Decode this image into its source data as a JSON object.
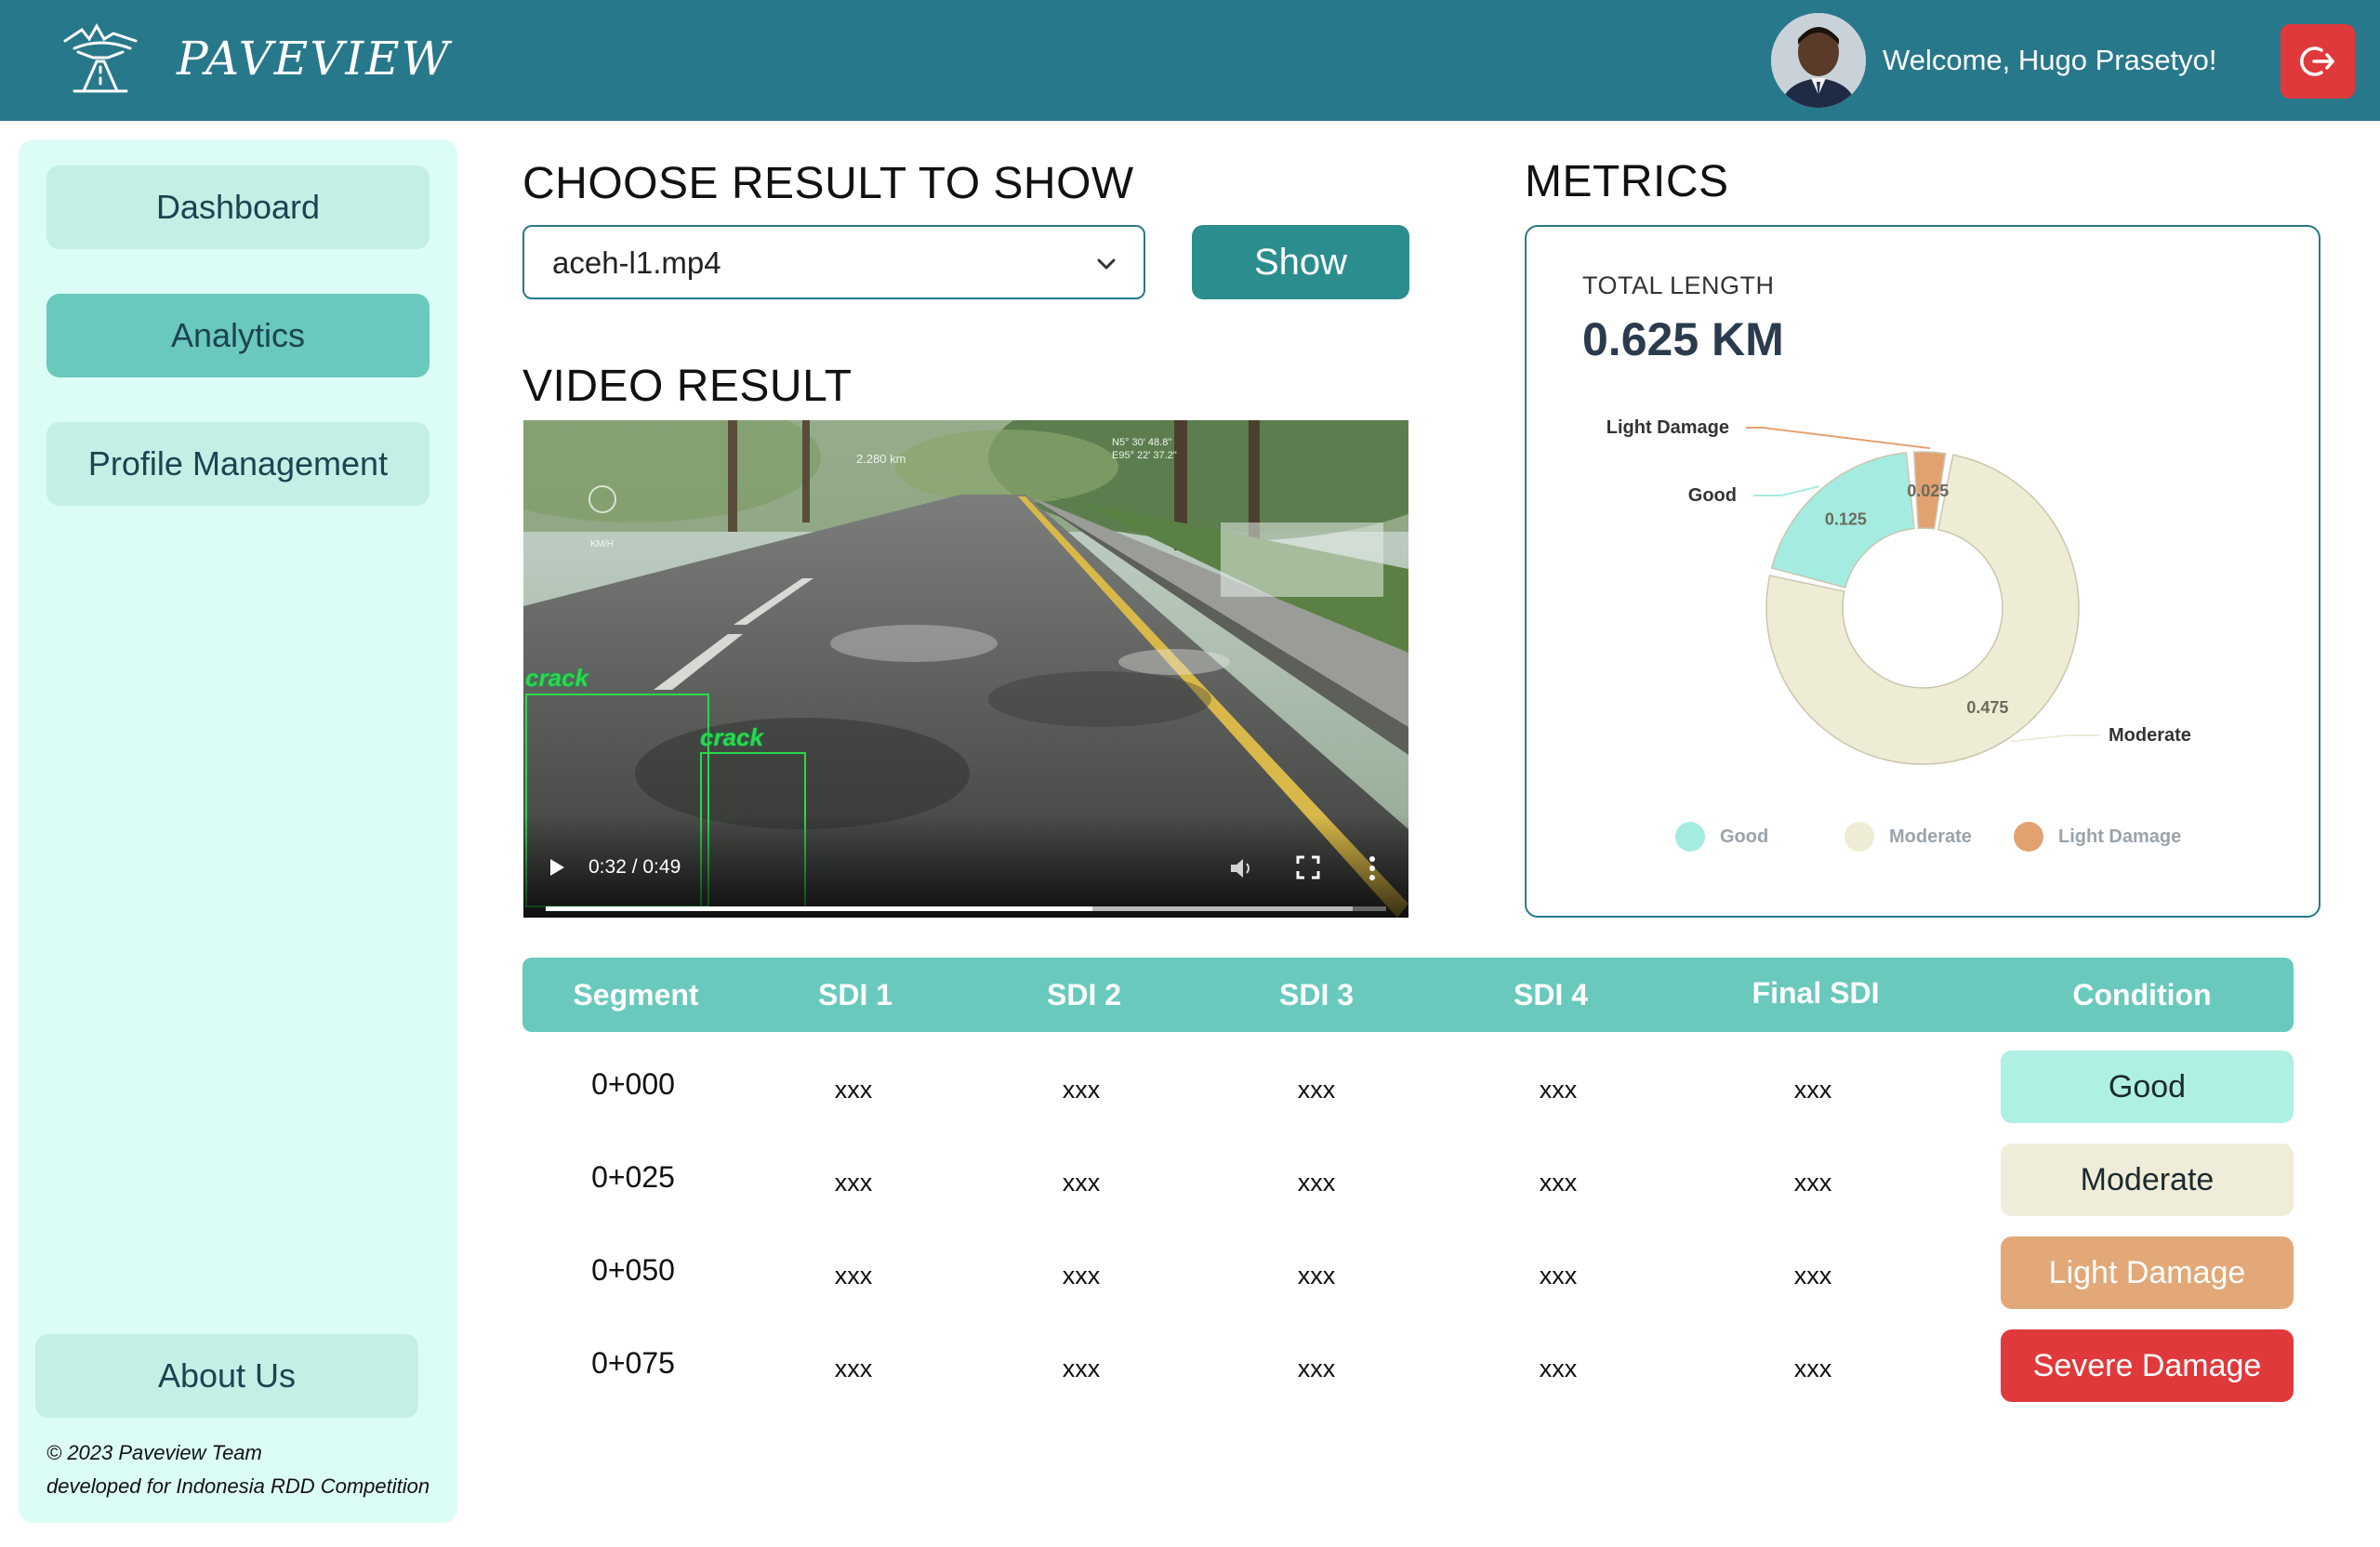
{
  "app": {
    "brand": "PAVEVIEW",
    "welcome_text": "Welcome, Hugo Prasetyo!",
    "icons": {
      "logo": "garuda-road-logo-icon",
      "logout": "logout-icon"
    }
  },
  "sidebar": {
    "items": [
      {
        "label": "Dashboard",
        "active": false
      },
      {
        "label": "Analytics",
        "active": true
      },
      {
        "label": "Profile Management",
        "active": false
      }
    ],
    "about_label": "About Us",
    "footer_line1": "© 2023 Paveview Team",
    "footer_line2": "developed for Indonesia RDD Competition"
  },
  "choose": {
    "heading": "CHOOSE RESULT TO SHOW",
    "selected": "aceh-l1.mp4",
    "show_label": "Show"
  },
  "video": {
    "heading": "VIDEO RESULT",
    "time": "0:32 / 0:49",
    "progress": 0.65,
    "buffered": 0.96,
    "detections": [
      "crack",
      "crack"
    ],
    "overlay_distance": "2.280 km",
    "overlay_speed_unit": "KM/H",
    "overlay_coords_1": "N5° 30' 48.8\"",
    "overlay_coords_2": "E95° 22' 37.2\""
  },
  "metrics": {
    "heading": "METRICS",
    "total_label": "TOTAL LENGTH",
    "total_value": "0.625 KM",
    "chart_data": {
      "type": "pie",
      "categories": [
        "Good",
        "Moderate",
        "Light Damage"
      ],
      "values": [
        0.125,
        0.475,
        0.025
      ],
      "value_labels": [
        "0.125",
        "0.475",
        "0.025"
      ],
      "colors": [
        "#a4ece1",
        "#efecd6",
        "#e2a270"
      ],
      "legend_position": "bottom"
    }
  },
  "table": {
    "headers": [
      "Segment",
      "SDI 1",
      "SDI 2",
      "SDI 3",
      "SDI 4",
      "Final SDI",
      "Condition"
    ],
    "rows": [
      {
        "segment": "0+000",
        "sdi1": "xxx",
        "sdi2": "xxx",
        "sdi3": "xxx",
        "sdi4": "xxx",
        "final": "xxx",
        "condition": "Good",
        "color": "#aef0e3",
        "text_color": "#1c2a30"
      },
      {
        "segment": "0+025",
        "sdi1": "xxx",
        "sdi2": "xxx",
        "sdi3": "xxx",
        "sdi4": "xxx",
        "final": "xxx",
        "condition": "Moderate",
        "color": "#efedd9",
        "text_color": "#1c2a30"
      },
      {
        "segment": "0+050",
        "sdi1": "xxx",
        "sdi2": "xxx",
        "sdi3": "xxx",
        "sdi4": "xxx",
        "final": "xxx",
        "condition": "Light Damage",
        "color": "#e2a877",
        "text_color": "#ffffff"
      },
      {
        "segment": "0+075",
        "sdi1": "xxx",
        "sdi2": "xxx",
        "sdi3": "xxx",
        "sdi4": "xxx",
        "final": "xxx",
        "condition": "Severe Damage",
        "color": "#e0393c",
        "text_color": "#ffffff"
      }
    ]
  }
}
